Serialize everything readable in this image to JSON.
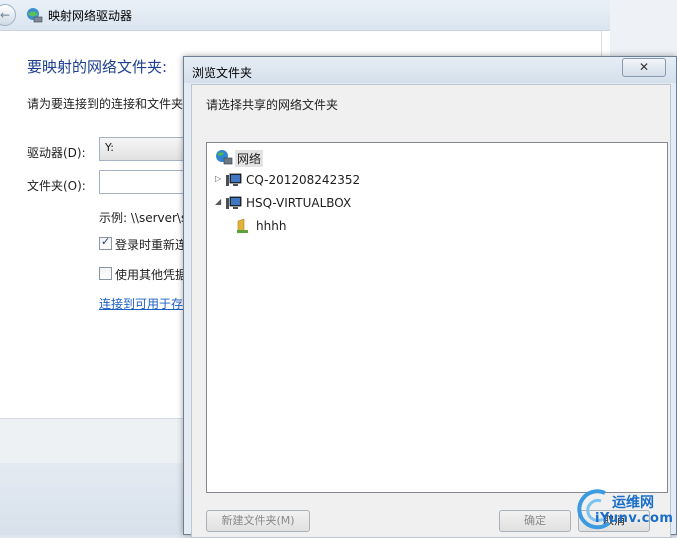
{
  "wizard": {
    "title": "映射网络驱动器",
    "heading": "要映射的网络文件夹:",
    "instruction": "请为要连接到的连接和文件夹",
    "drive_label": "驱动器(D):",
    "drive_value": "Y:",
    "folder_label": "文件夹(O):",
    "folder_value": "",
    "example": "示例: \\\\server\\s",
    "reconnect_label": "登录时重新连",
    "reconnect_checked": true,
    "other_creds_label": "使用其他凭据",
    "other_creds_checked": false,
    "connect_link": "连接到可用于存"
  },
  "dialog": {
    "title": "浏览文件夹",
    "close_label": "✕",
    "prompt": "请选择共享的网络文件夹",
    "tree": {
      "root": "网络",
      "items": [
        {
          "label": "CQ-201208242352",
          "expanded": false
        },
        {
          "label": "HSQ-VIRTUALBOX",
          "expanded": true
        }
      ],
      "child": "hhhh"
    },
    "new_folder_label": "新建文件夹(M)",
    "ok_label": "确定",
    "cancel_label": "取消"
  },
  "watermark": {
    "line1": "运维网",
    "line2": "iYunv.com"
  },
  "colors": {
    "heading": "#1e3f8f",
    "link": "#1c5ec4",
    "dialog_bg": "#e4ebf3"
  }
}
